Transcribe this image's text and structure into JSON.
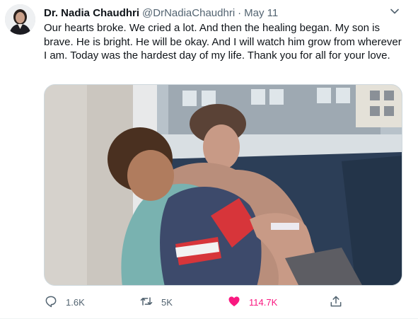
{
  "tweet": {
    "author_name": "Dr. Nadia Chaudhri",
    "author_handle": "@DrNadiaChaudhri",
    "separator": "·",
    "date": "May 11",
    "text": "Our hearts broke. We cried a lot. And then the healing began. My son is brave. He is bright. He will be okay. And I will watch him grow from wherever I am. Today was the hardest day of my life. Thank you for all for your love.",
    "icons": {
      "more": "more-icon",
      "reply": "reply-icon",
      "retweet": "retweet-icon",
      "like": "heart-icon",
      "share": "share-icon"
    },
    "colors": {
      "like_active": "#f91880",
      "secondary_text": "#536471"
    }
  },
  "actions": {
    "replies": "1.6K",
    "retweets": "5K",
    "likes": "114.7K"
  }
}
